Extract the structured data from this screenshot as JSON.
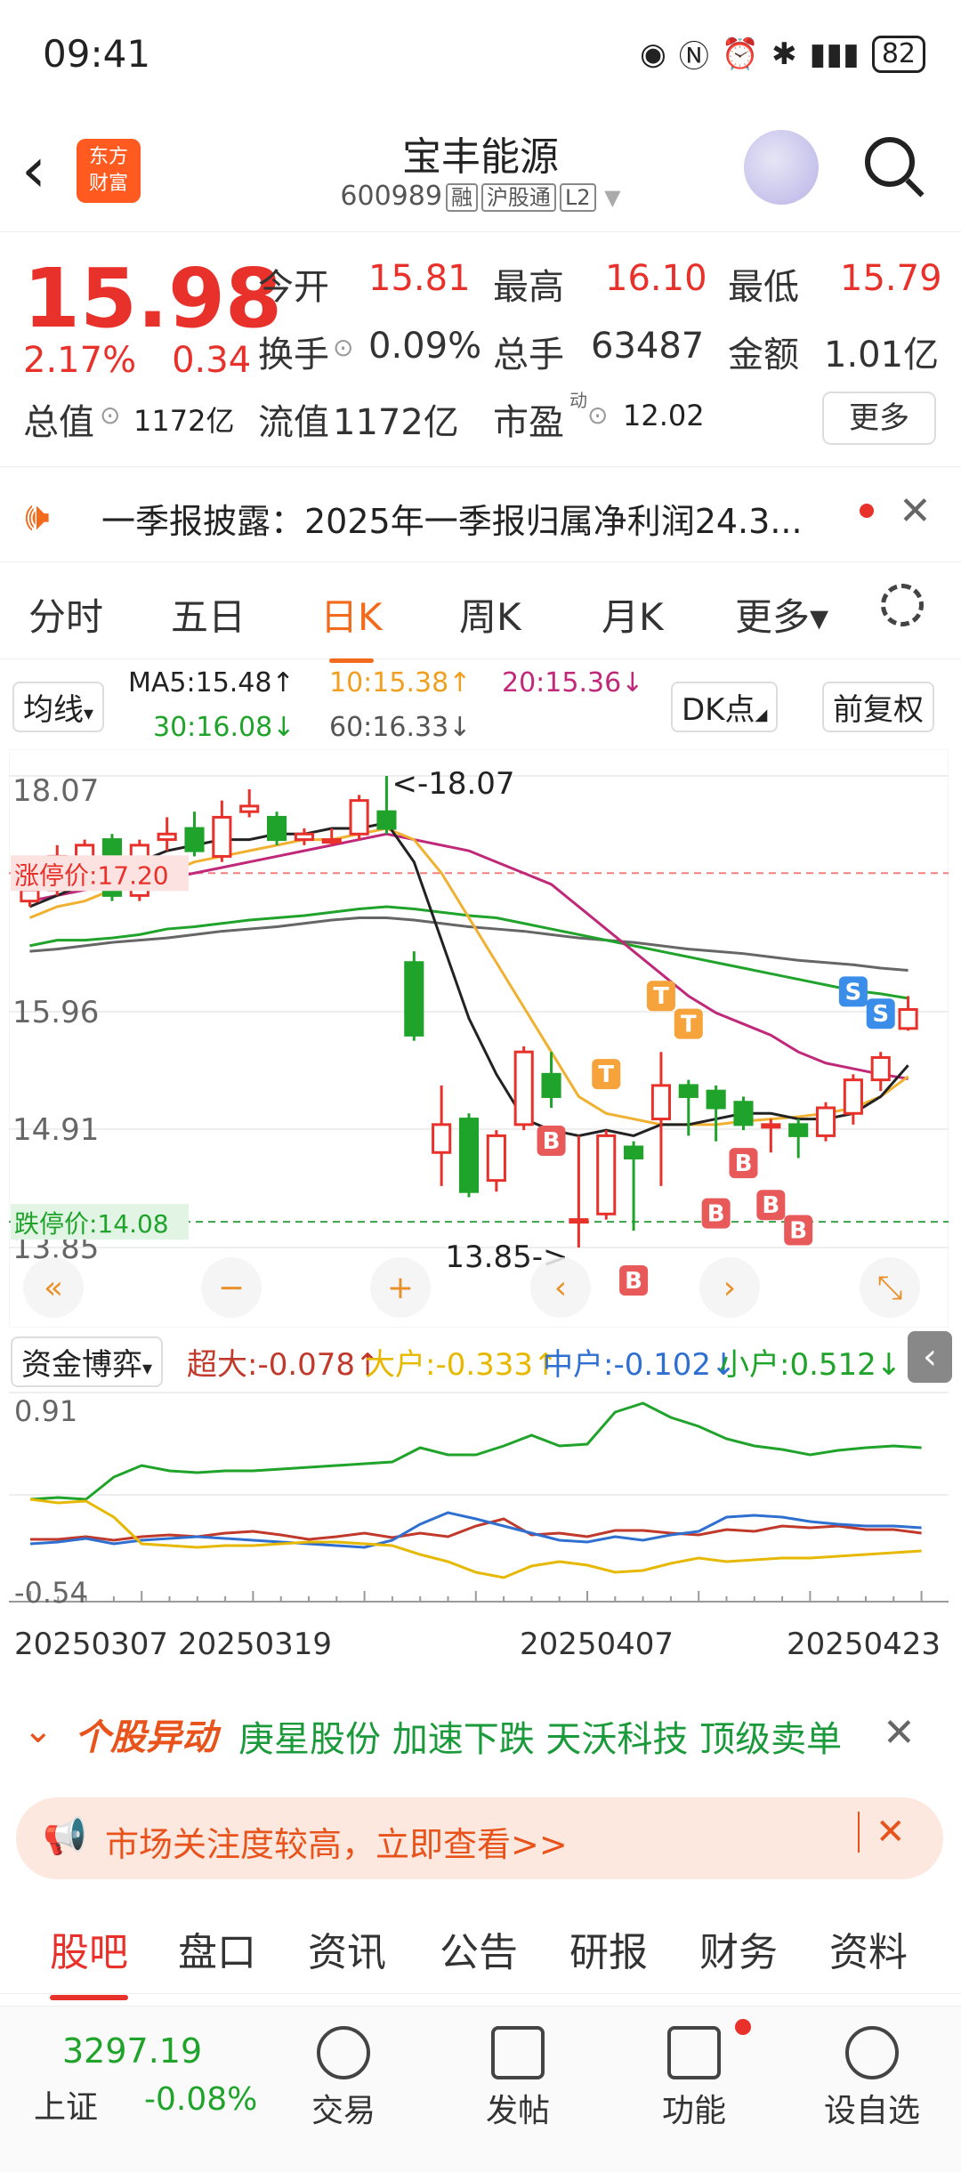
{
  "status": {
    "time": "09:41",
    "battery": "82"
  },
  "header": {
    "title": "宝丰能源",
    "code": "600989",
    "tags": [
      "融",
      "沪股通",
      "L2"
    ],
    "logo": "东方\n财富"
  },
  "quote": {
    "price": "15.98",
    "pct": "2.17%",
    "chg": "0.34",
    "open_label": "今开",
    "open": "15.81",
    "high_label": "最高",
    "high": "16.10",
    "low_label": "最低",
    "low": "15.79",
    "turnover_label": "换手",
    "turnover": "0.09%",
    "volume_label": "总手",
    "volume": "63487",
    "amount_label": "金额",
    "amount": "1.01亿",
    "mcap_label": "总值",
    "mcap": "1172亿",
    "float_label": "流值",
    "float": "1172亿",
    "pe_label": "市盈",
    "pe_sup": "动",
    "pe": "12.02",
    "more": "更多"
  },
  "announce": {
    "text": "一季报披露：2025年一季报归属净利润24.3..."
  },
  "ktabs": [
    "分时",
    "五日",
    "日K",
    "周K",
    "月K",
    "更多▾"
  ],
  "ma": {
    "selector": "均线",
    "ma5": "MA5:15.48↑",
    "ma10": "10:15.38↑",
    "ma20": "20:15.36↓",
    "ma30": "30:16.08↓",
    "ma60": "60:16.33↓",
    "dk": "DK点",
    "adj": "前复权"
  },
  "chart_data": {
    "type": "candlestick",
    "y_labels": [
      "18.07",
      "15.96",
      "14.91",
      "13.85"
    ],
    "limit_up_label": "涨停价:17.20",
    "limit_down_label": "跌停价:14.08",
    "max_annot": "<-18.07",
    "min_annot": "13.85->",
    "candles": [
      {
        "o": 16.95,
        "c": 17.05,
        "h": 17.1,
        "l": 16.9
      },
      {
        "o": 17.05,
        "c": 17.35,
        "h": 17.45,
        "l": 17.0
      },
      {
        "o": 17.2,
        "c": 17.45,
        "h": 17.5,
        "l": 17.1
      },
      {
        "o": 17.5,
        "c": 17.0,
        "h": 17.55,
        "l": 16.95
      },
      {
        "o": 17.0,
        "c": 17.45,
        "h": 17.5,
        "l": 16.95
      },
      {
        "o": 17.5,
        "c": 17.55,
        "h": 17.7,
        "l": 17.4
      },
      {
        "o": 17.6,
        "c": 17.4,
        "h": 17.75,
        "l": 17.35
      },
      {
        "o": 17.35,
        "c": 17.7,
        "h": 17.85,
        "l": 17.3
      },
      {
        "o": 17.75,
        "c": 17.8,
        "h": 17.95,
        "l": 17.7
      },
      {
        "o": 17.7,
        "c": 17.5,
        "h": 17.75,
        "l": 17.45
      },
      {
        "o": 17.5,
        "c": 17.55,
        "h": 17.6,
        "l": 17.45
      },
      {
        "o": 17.5,
        "c": 17.5,
        "h": 17.6,
        "l": 17.45
      },
      {
        "o": 17.55,
        "c": 17.85,
        "h": 17.9,
        "l": 17.5
      },
      {
        "o": 17.75,
        "c": 17.6,
        "h": 18.07,
        "l": 17.55
      },
      {
        "o": 16.4,
        "c": 15.75,
        "h": 16.5,
        "l": 15.7
      },
      {
        "o": 14.7,
        "c": 14.95,
        "h": 15.3,
        "l": 14.4
      },
      {
        "o": 15.0,
        "c": 14.35,
        "h": 15.05,
        "l": 14.3
      },
      {
        "o": 14.45,
        "c": 14.85,
        "h": 14.9,
        "l": 14.35
      },
      {
        "o": 14.95,
        "c": 15.6,
        "h": 15.65,
        "l": 14.9
      },
      {
        "o": 15.4,
        "c": 15.2,
        "h": 15.6,
        "l": 15.1
      },
      {
        "o": 14.1,
        "c": 14.1,
        "h": 14.85,
        "l": 13.85
      },
      {
        "o": 14.15,
        "c": 14.85,
        "h": 14.9,
        "l": 14.1
      },
      {
        "o": 14.75,
        "c": 14.65,
        "h": 14.8,
        "l": 14.0
      },
      {
        "o": 15.0,
        "c": 15.3,
        "h": 15.6,
        "l": 14.4
      },
      {
        "o": 15.3,
        "c": 15.2,
        "h": 15.35,
        "l": 14.85
      },
      {
        "o": 15.25,
        "c": 15.1,
        "h": 15.3,
        "l": 14.8
      },
      {
        "o": 15.15,
        "c": 14.95,
        "h": 15.2,
        "l": 14.9
      },
      {
        "o": 14.95,
        "c": 14.95,
        "h": 15.0,
        "l": 14.7
      },
      {
        "o": 14.95,
        "c": 14.85,
        "h": 15.0,
        "l": 14.65
      },
      {
        "o": 14.85,
        "c": 15.1,
        "h": 15.15,
        "l": 14.8
      },
      {
        "o": 15.05,
        "c": 15.35,
        "h": 15.4,
        "l": 14.95
      },
      {
        "o": 15.35,
        "c": 15.55,
        "h": 15.6,
        "l": 15.25
      },
      {
        "o": 15.81,
        "c": 15.98,
        "h": 16.1,
        "l": 15.79
      }
    ],
    "ma5": [
      16.9,
      17.0,
      17.1,
      17.15,
      17.3,
      17.4,
      17.45,
      17.5,
      17.5,
      17.55,
      17.55,
      17.6,
      17.6,
      17.65,
      17.3,
      16.6,
      15.9,
      15.4,
      15.0,
      14.9,
      14.85,
      14.9,
      14.85,
      14.95,
      14.95,
      15.0,
      15.05,
      15.05,
      15.0,
      15.0,
      15.05,
      15.2,
      15.48
    ],
    "ma10": [
      16.8,
      16.9,
      16.95,
      17.05,
      17.1,
      17.2,
      17.3,
      17.35,
      17.4,
      17.45,
      17.5,
      17.5,
      17.55,
      17.6,
      17.5,
      17.2,
      16.8,
      16.4,
      16.0,
      15.6,
      15.2,
      15.05,
      15.0,
      14.95,
      14.95,
      14.95,
      14.98,
      15.0,
      15.02,
      15.05,
      15.1,
      15.2,
      15.38
    ],
    "ma20": [
      16.95,
      17.0,
      17.05,
      17.1,
      17.12,
      17.15,
      17.2,
      17.25,
      17.3,
      17.35,
      17.4,
      17.45,
      17.5,
      17.55,
      17.5,
      17.45,
      17.4,
      17.3,
      17.2,
      17.1,
      16.9,
      16.7,
      16.5,
      16.3,
      16.1,
      15.95,
      15.85,
      15.75,
      15.6,
      15.5,
      15.45,
      15.4,
      15.36
    ],
    "ma30": [
      16.55,
      16.6,
      16.6,
      16.62,
      16.65,
      16.7,
      16.72,
      16.75,
      16.78,
      16.8,
      16.82,
      16.85,
      16.88,
      16.9,
      16.88,
      16.85,
      16.82,
      16.8,
      16.75,
      16.7,
      16.65,
      16.6,
      16.55,
      16.5,
      16.45,
      16.4,
      16.35,
      16.3,
      16.25,
      16.2,
      16.15,
      16.12,
      16.08
    ],
    "ma60": [
      16.5,
      16.52,
      16.55,
      16.58,
      16.6,
      16.62,
      16.65,
      16.68,
      16.7,
      16.72,
      16.75,
      16.78,
      16.8,
      16.8,
      16.78,
      16.75,
      16.72,
      16.7,
      16.68,
      16.65,
      16.62,
      16.6,
      16.58,
      16.55,
      16.52,
      16.5,
      16.48,
      16.45,
      16.42,
      16.4,
      16.38,
      16.35,
      16.33
    ],
    "markers": [
      {
        "i": 19,
        "t": "B"
      },
      {
        "i": 21,
        "t": "T"
      },
      {
        "i": 22,
        "t": "B"
      },
      {
        "i": 23,
        "t": "T"
      },
      {
        "i": 24,
        "t": "T"
      },
      {
        "i": 25,
        "t": "B"
      },
      {
        "i": 26,
        "t": "B"
      },
      {
        "i": 27,
        "t": "B"
      },
      {
        "i": 28,
        "t": "B"
      },
      {
        "i": 30,
        "t": "S"
      },
      {
        "i": 31,
        "t": "S"
      }
    ]
  },
  "flow": {
    "selector": "资金博弈",
    "super": "超大:-0.078↑",
    "big": "大户:-0.333↑",
    "mid": "中户:-0.102↓",
    "small": "小户:0.512↓",
    "y_top": "0.91",
    "y_bottom": "-0.54",
    "colors": {
      "super": "#c0392b",
      "big": "#e6b800",
      "mid": "#2f6fd0",
      "small": "#1fa32a"
    }
  },
  "dates": [
    "20250307",
    "20250319",
    "20250407",
    "20250423"
  ],
  "alert": {
    "brand": "个股异动",
    "text": "庚星股份 加速下跌 天沃科技 顶级卖单"
  },
  "market": {
    "text": "市场关注度较高，立即查看>>"
  },
  "btabs": [
    "股吧",
    "盘口",
    "资讯",
    "公告",
    "研报",
    "财务",
    "资料"
  ],
  "footer": {
    "index_value": "3297.19",
    "index_name": "上证",
    "index_pct": "-0.08%",
    "items": [
      "交易",
      "发帖",
      "功能",
      "设自选"
    ]
  }
}
